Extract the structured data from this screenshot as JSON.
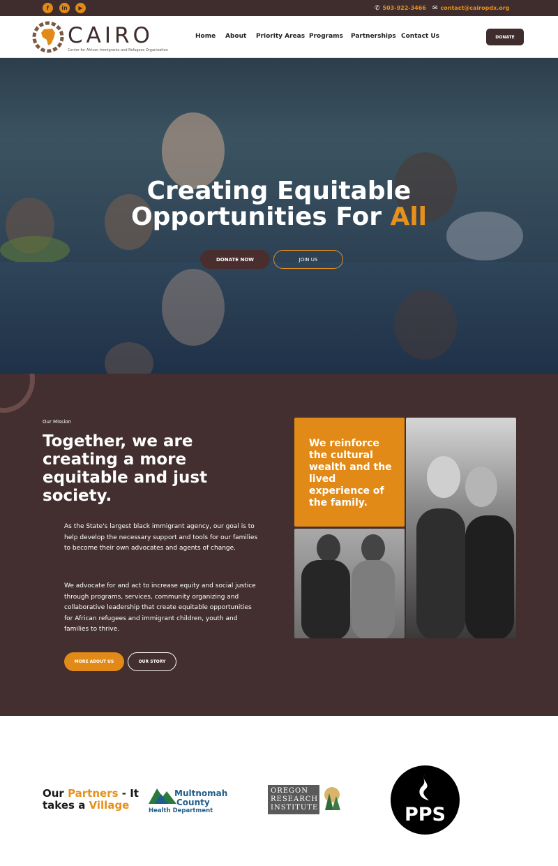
{
  "topbar": {
    "social": [
      "facebook-icon",
      "linkedin-icon",
      "youtube-icon"
    ],
    "phone": "503-922-3466",
    "email": "contact@cairopdx.org"
  },
  "nav": {
    "logo_word": "CAIRO",
    "logo_tagline": "Center for African Immigrants and Refugees Organization",
    "menu": [
      "Home",
      "About",
      "Priority Areas",
      "Programs",
      "Partnerships",
      "Contact Us"
    ],
    "donate": "DONATE"
  },
  "hero": {
    "line1": "Creating Equitable",
    "line2_a": "Opportunities For ",
    "line2_b": "All",
    "donate_now": "DONATE NOW",
    "join_us": "JOIN US"
  },
  "mission": {
    "label": "Our Mission",
    "title": "Together, we are creating a more equitable and just society.",
    "p1": "As the State's largest black immigrant agency, our goal is to help develop the necessary support and tools for our families to become their own advocates and agents of change.",
    "p2": "We advocate for and act to increase equity and social justice through programs, services, community organizing and collaborative leadership that create equitable opportunities for African refugees and immigrant children, youth and families to thrive.",
    "more_about": "MORE ABOUT US",
    "our_story": "OUR STORY",
    "quote": "We reinforce the cultural wealth and the lived experience of the family."
  },
  "partners": {
    "h_a": "Our ",
    "h_b": "Partners",
    "h_c": " - It",
    "h_d": "takes a ",
    "h_e": "Village",
    "multnomah_1": "Multnomah",
    "multnomah_2": "County",
    "multnomah_3": "Health Department",
    "ori_1": "OREGON",
    "ori_2": "RESEARCH",
    "ori_3": "INSTITUTE",
    "pps": "PPS"
  },
  "colors": {
    "brown": "#432f2f",
    "orange": "#e28a17"
  }
}
